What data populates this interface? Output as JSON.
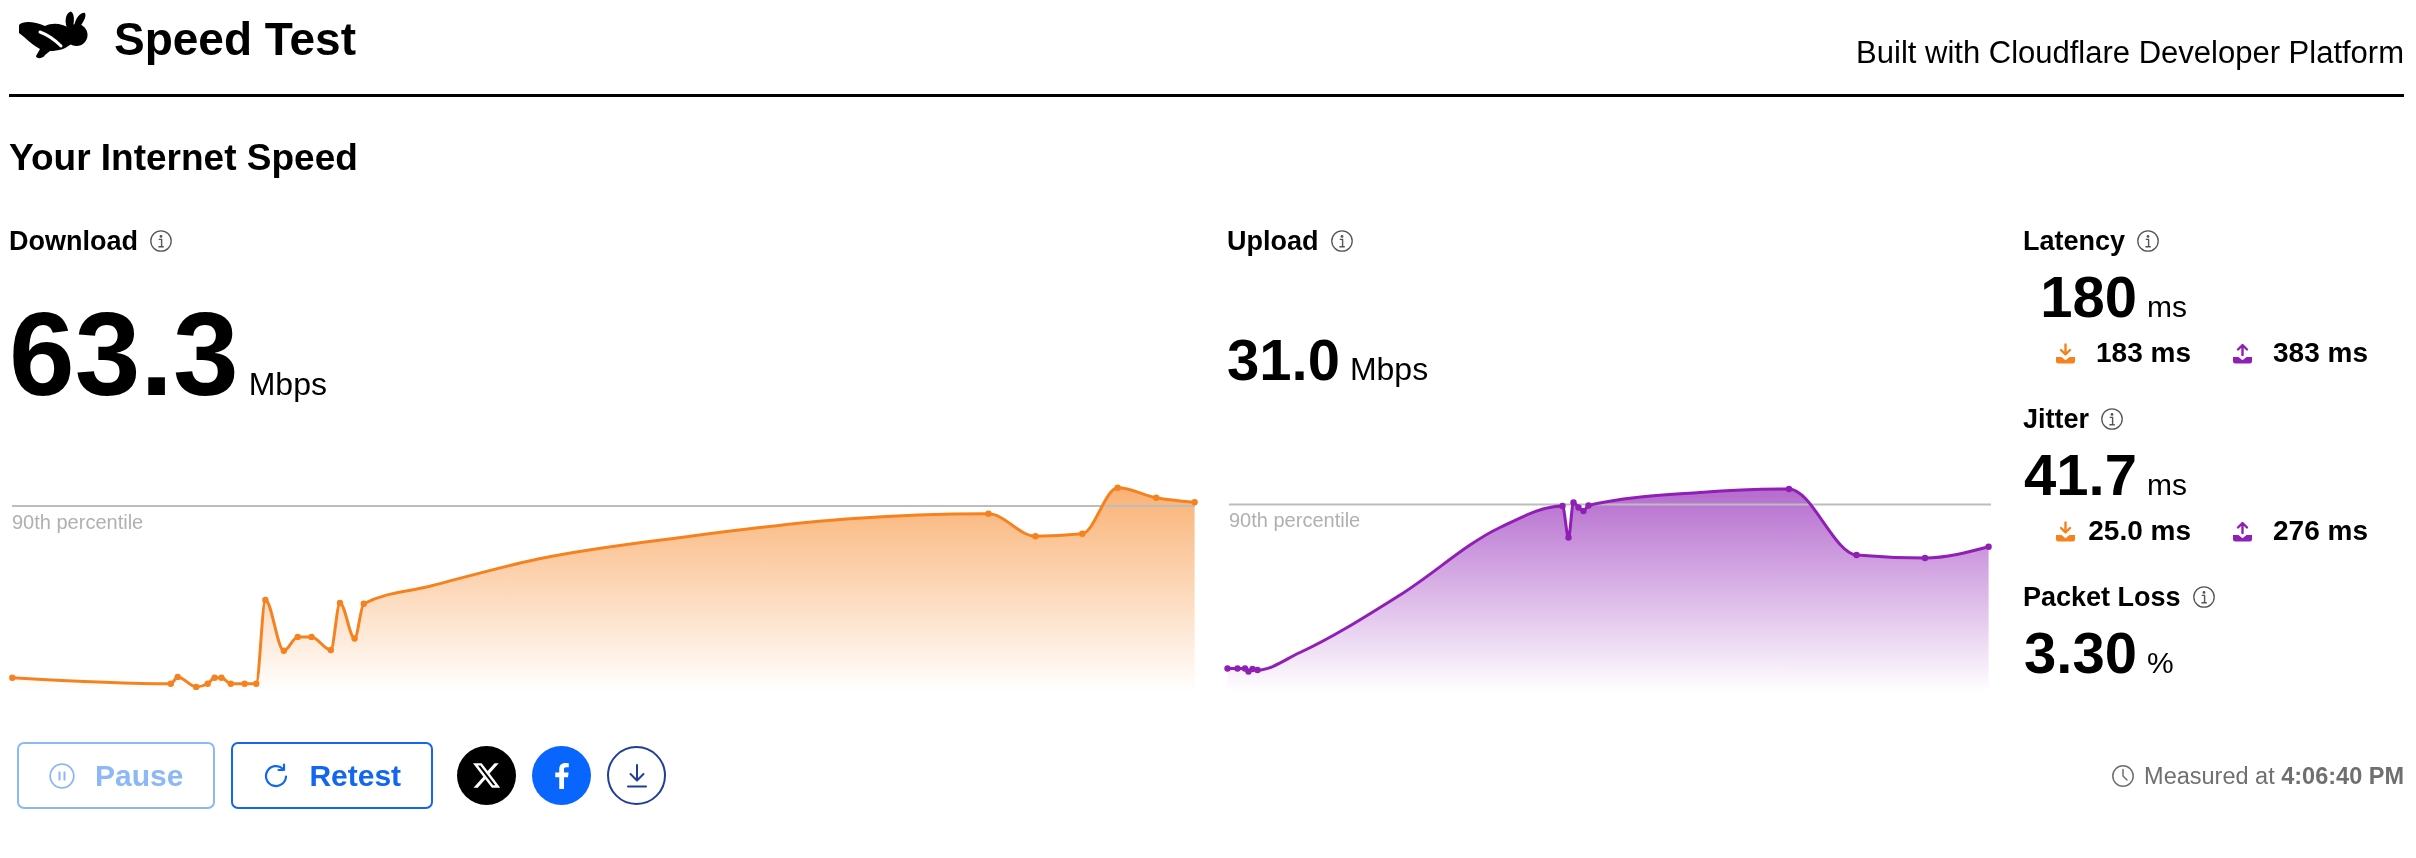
{
  "header": {
    "title": "Speed Test",
    "credit": "Built with Cloudflare Developer Platform"
  },
  "heading": "Your Internet Speed",
  "throughput": [
    {
      "kind": "download",
      "label": "Download",
      "value": "63.3",
      "unit": "Mbps",
      "percentile_label": "90th percentile"
    },
    {
      "kind": "upload",
      "label": "Upload",
      "value": "31.0",
      "unit": "Mbps",
      "percentile_label": "90th percentile"
    }
  ],
  "metrics": [
    {
      "label": "Latency",
      "value": "180",
      "unit": "ms",
      "breakdown": [
        {
          "kind": "download",
          "value": "183 ms"
        },
        {
          "kind": "upload",
          "value": "383 ms"
        }
      ]
    },
    {
      "label": "Jitter",
      "value": "41.7",
      "unit": "ms",
      "breakdown": [
        {
          "kind": "download",
          "value": "25.0 ms"
        },
        {
          "kind": "upload",
          "value": "276 ms"
        }
      ]
    },
    {
      "label": "Packet Loss",
      "value": "3.30",
      "unit": "%"
    }
  ],
  "actions": [
    {
      "kind": "pause",
      "label": "Pause",
      "disabled": true
    },
    {
      "kind": "retest",
      "label": "Retest",
      "disabled": false
    },
    {
      "kind": "x",
      "disabled": false
    },
    {
      "kind": "facebook",
      "disabled": false
    },
    {
      "kind": "download",
      "disabled": false
    }
  ],
  "footer": {
    "measured": "Measured at **4:06:40 PM**"
  }
}
